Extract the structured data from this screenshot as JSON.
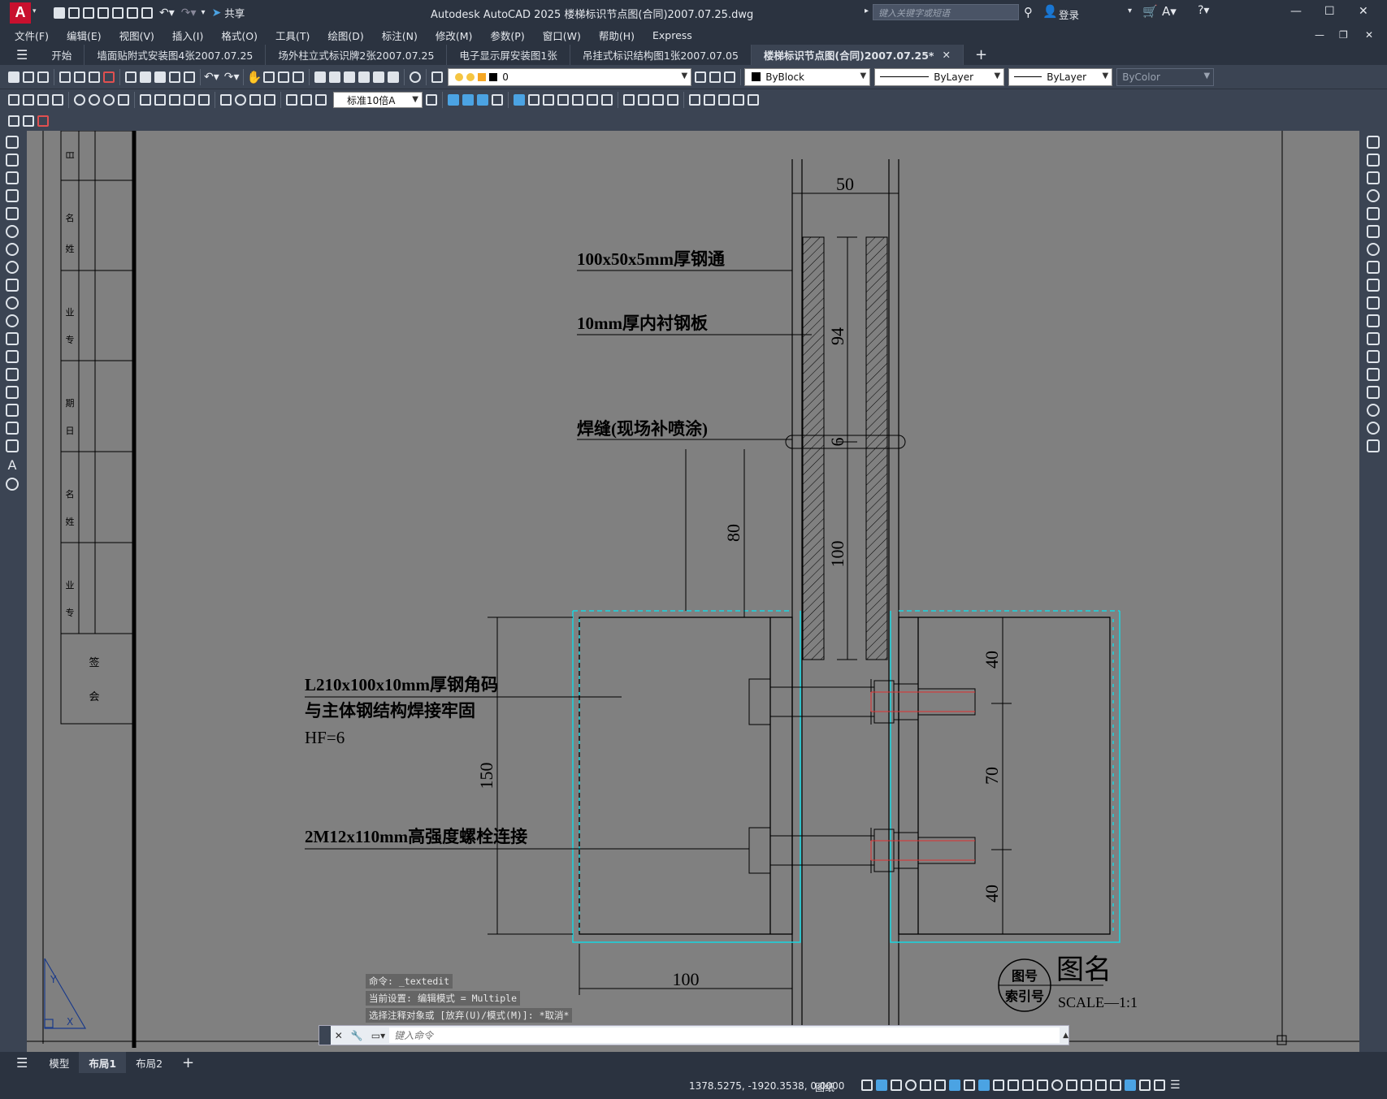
{
  "window": {
    "title": "Autodesk AutoCAD 2025    楼梯标识节点图(合同)2007.07.25.dwg",
    "share": "共享",
    "search_placeholder": "键入关键字或短语",
    "login": "登录"
  },
  "menu": [
    "文件(F)",
    "编辑(E)",
    "视图(V)",
    "插入(I)",
    "格式(O)",
    "工具(T)",
    "绘图(D)",
    "标注(N)",
    "修改(M)",
    "参数(P)",
    "窗口(W)",
    "帮助(H)",
    "Express"
  ],
  "tabs": [
    "开始",
    "墙面贴附式安装图4张2007.07.25",
    "场外柱立式标识牌2张2007.07.25",
    "电子显示屏安装图1张",
    "吊挂式标识结构图1张2007.07.05",
    "楼梯标识节点图(合同)2007.07.25*"
  ],
  "toolbar": {
    "layer": "0",
    "color": "ByBlock",
    "linetype": "ByLayer",
    "lineweight": "ByLayer",
    "plotstyle": "ByColor",
    "dimstyle": "标准10倍A"
  },
  "drawing": {
    "labels": {
      "steel_tube": "100x50x5mm厚钢通",
      "liner": "10mm厚内衬钢板",
      "weld": "焊缝(现场补喷涂)",
      "angle1": "L210x100x10mm厚钢角码",
      "angle2": "与主体钢结构焊接牢固",
      "hf": "HF=6",
      "bolt": "2M12x110mm高强度螺栓连接"
    },
    "dims": {
      "d50": "50",
      "d94": "94",
      "d6": "6",
      "d80": "80",
      "d100v": "100",
      "d150": "150",
      "d40a": "40",
      "d70": "70",
      "d40b": "40",
      "d100h": "100"
    },
    "titleblock": {
      "name": "图名",
      "scale": "SCALE—1:1",
      "num1": "图号",
      "num2": "索引号"
    },
    "sideblock": [
      "日",
      "名",
      "姓",
      "业",
      "专",
      "期",
      "日",
      "名",
      "姓",
      "业",
      "专",
      "签",
      "会"
    ]
  },
  "command": {
    "history": [
      "命令: _textedit",
      "当前设置: 编辑模式 = Multiple",
      "选择注释对象或 [放弃(U)/模式(M)]: *取消*"
    ],
    "placeholder": "键入命令"
  },
  "layouts": [
    "模型",
    "布局1",
    "布局2"
  ],
  "status": {
    "coords": "1378.5275, -1920.3538, 0.0000",
    "paper": "图纸"
  }
}
